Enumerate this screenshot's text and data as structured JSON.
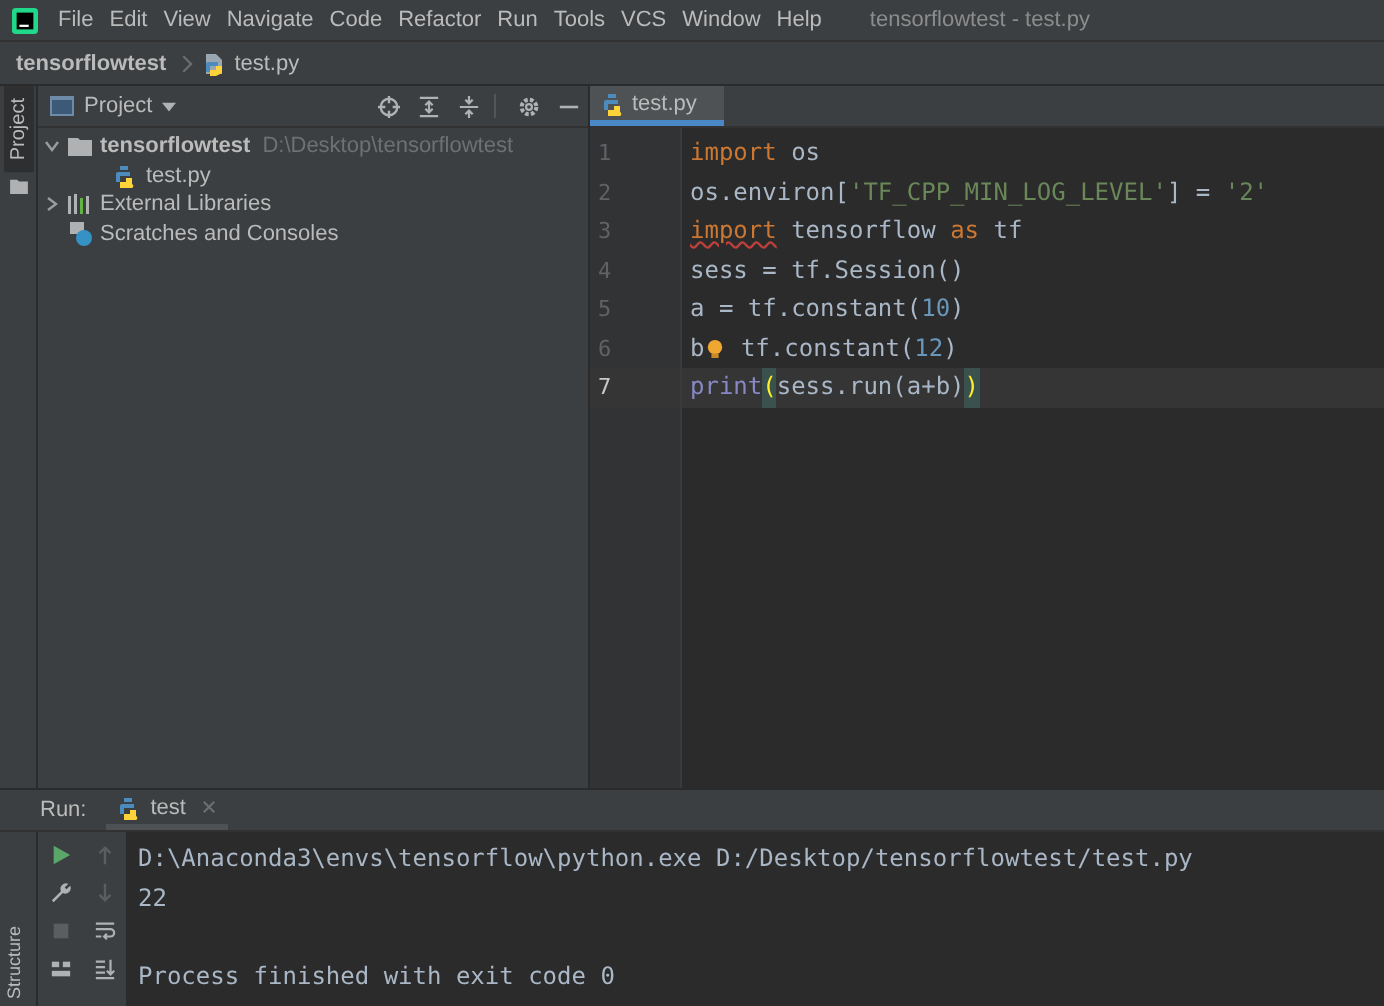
{
  "menu": [
    "File",
    "Edit",
    "View",
    "Navigate",
    "Code",
    "Refactor",
    "Run",
    "Tools",
    "VCS",
    "Window",
    "Help"
  ],
  "window": {
    "title": "tensorflowtest - test.py"
  },
  "breadcrumb": [
    "tensorflowtest",
    "test.py"
  ],
  "left_tabs": {
    "top": "Project",
    "bottom": "Structure"
  },
  "project": {
    "title": "Project",
    "tree": [
      {
        "label": "tensorflowtest",
        "path": "D:\\Desktop\\tensorflowtest",
        "kind": "folder",
        "expanded": true,
        "children": [
          {
            "label": "test.py",
            "kind": "python"
          }
        ]
      },
      {
        "label": "External Libraries",
        "kind": "library",
        "expanded": false
      },
      {
        "label": "Scratches and Consoles",
        "kind": "scratches"
      }
    ]
  },
  "editor": {
    "tabs": [
      {
        "label": "test.py",
        "selected": true
      }
    ],
    "lines": [
      {
        "number": "1",
        "current": false,
        "tokens": [
          {
            "text": "import",
            "kind": "keyword"
          },
          {
            "text": " os",
            "kind": "plain"
          }
        ]
      },
      {
        "number": "2",
        "current": false,
        "tokens": [
          {
            "text": "os.environ[",
            "kind": "plain"
          },
          {
            "text": "'TF_CPP_MIN_LOG_LEVEL'",
            "kind": "string"
          },
          {
            "text": "] = ",
            "kind": "plain"
          },
          {
            "text": "'2'",
            "kind": "string"
          }
        ]
      },
      {
        "number": "3",
        "current": false,
        "tokens": [
          {
            "text": "import",
            "kind": "keyword-warning"
          },
          {
            "text": " tensorflow ",
            "kind": "plain"
          },
          {
            "text": "as",
            "kind": "keyword"
          },
          {
            "text": " tf",
            "kind": "plain"
          }
        ]
      },
      {
        "number": "4",
        "current": false,
        "tokens": [
          {
            "text": "sess = tf.Session()",
            "kind": "plain"
          }
        ]
      },
      {
        "number": "5",
        "current": false,
        "tokens": [
          {
            "text": "a = tf.constant(",
            "kind": "plain"
          },
          {
            "text": "10",
            "kind": "number"
          },
          {
            "text": ")",
            "kind": "plain"
          }
        ]
      },
      {
        "number": "6",
        "current": false,
        "tokens": [
          {
            "text": "b",
            "kind": "plain"
          },
          {
            "kind": "bulb"
          },
          {
            "text": " tf.constant(",
            "kind": "plain"
          },
          {
            "text": "12",
            "kind": "number"
          },
          {
            "text": ")",
            "kind": "plain"
          }
        ]
      },
      {
        "number": "7",
        "current": true,
        "tokens": [
          {
            "text": "print",
            "kind": "builtin"
          },
          {
            "text": "(",
            "kind": "brace-match"
          },
          {
            "text": "sess.run(a+b)",
            "kind": "plain"
          },
          {
            "text": ")",
            "kind": "brace-match"
          }
        ]
      }
    ]
  },
  "run": {
    "label": "Run:",
    "tabs": [
      {
        "label": "test",
        "selected": true
      }
    ],
    "output": [
      [
        "D:\\Anaconda3\\envs\\tensorflow\\python.exe D:/Desktop/tensorflowtest/test.py",
        "22"
      ],
      [
        "Process finished with exit code 0"
      ]
    ]
  }
}
